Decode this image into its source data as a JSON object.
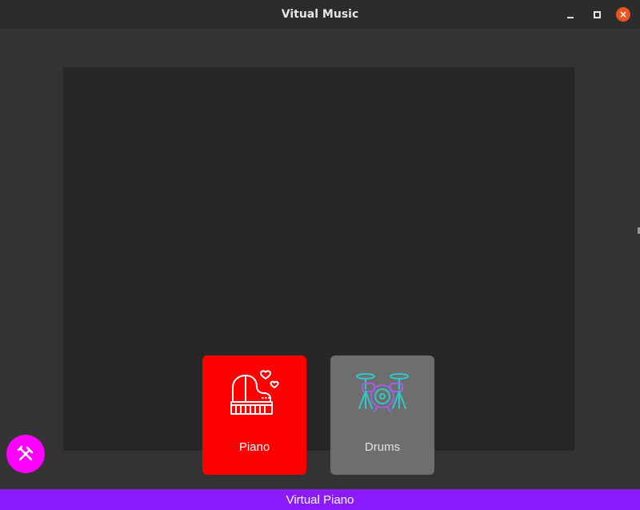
{
  "window": {
    "title": "Vitual Music",
    "close_glyph": "×"
  },
  "instruments": [
    {
      "label": "Piano",
      "icon": "grand-piano-icon",
      "selected": true,
      "color": "#ff0000"
    },
    {
      "label": "Drums",
      "icon": "drum-kit-icon",
      "selected": false,
      "color": "#6e6e6e"
    }
  ],
  "fab": {
    "icon": "tools-icon",
    "color": "#ff00ff"
  },
  "statusbar": {
    "text": "Virtual Piano",
    "color": "#8a1aff"
  },
  "theme": {
    "background": "#333333",
    "canvas": "#272727",
    "close_button": "#e95420"
  }
}
